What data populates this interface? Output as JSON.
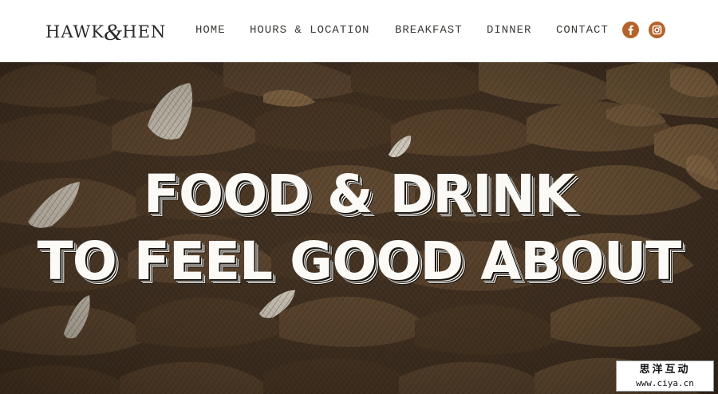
{
  "brand": {
    "name_left": "HAWK",
    "ampersand": "&",
    "name_right": "HEN"
  },
  "nav": {
    "items": [
      {
        "label": "HOME"
      },
      {
        "label": "HOURS & LOCATION"
      },
      {
        "label": "BREAKFAST"
      },
      {
        "label": "DINNER"
      },
      {
        "label": "CONTACT"
      }
    ]
  },
  "social": {
    "icons": [
      "facebook-icon",
      "instagram-icon"
    ],
    "accent_color": "#b5632a"
  },
  "hero": {
    "line_1": "FOOD & DRINK",
    "line_2": "TO FEEL GOOD ABOUT",
    "text_color": "#fbfaf6",
    "background_color": "#3a2c1f"
  },
  "watermark": {
    "title": "思洋互动",
    "url": "www.ciya.cn"
  }
}
